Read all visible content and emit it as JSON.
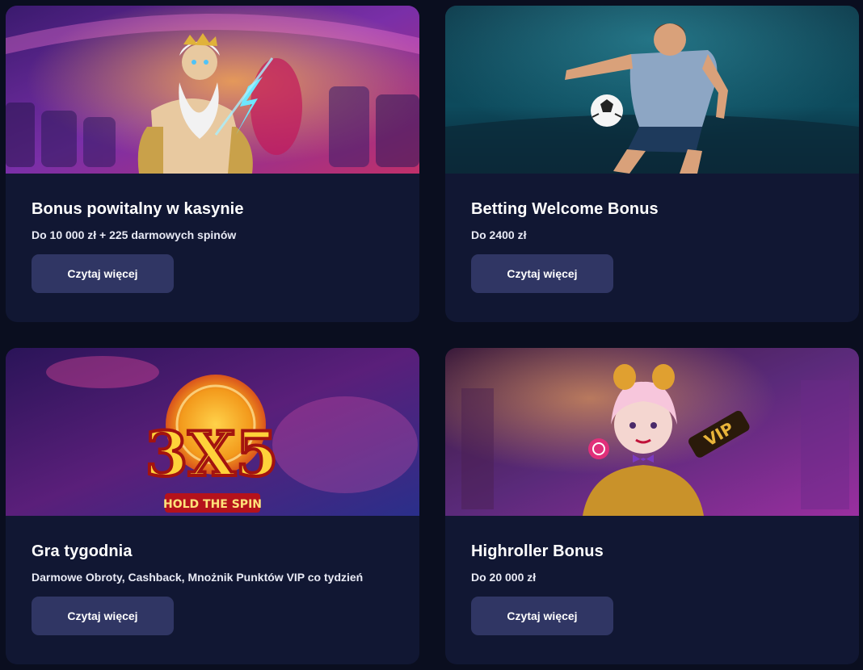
{
  "colors": {
    "page_background": "#0a0e1f",
    "card_background": "#111733",
    "button_background": "#303664",
    "text_primary": "#ffffff"
  },
  "cards": [
    {
      "title": "Bonus powitalny w kasynie",
      "subtitle": "Do 10 000 zł + 225 darmowych spinów",
      "button_label": "Czytaj więcej",
      "image": "zeus-casino-banner"
    },
    {
      "title": "Betting Welcome Bonus",
      "subtitle": "Do 2400 zł",
      "button_label": "Czytaj więcej",
      "image": "football-player-banner"
    },
    {
      "title": "Gra tygodnia",
      "subtitle": "Darmowe Obroty, Cashback, Mnożnik Punktów VIP co tydzień",
      "button_label": "Czytaj więcej",
      "image": "3x5-hold-the-spin-banner",
      "image_text": {
        "logo": "3X5",
        "tagline": "HOLD THE SPIN"
      }
    },
    {
      "title": "Highroller Bonus",
      "subtitle": "Do 20 000 zł",
      "button_label": "Czytaj więcej",
      "image": "vip-clown-girl-banner",
      "image_text": {
        "badge": "VIP"
      }
    }
  ]
}
